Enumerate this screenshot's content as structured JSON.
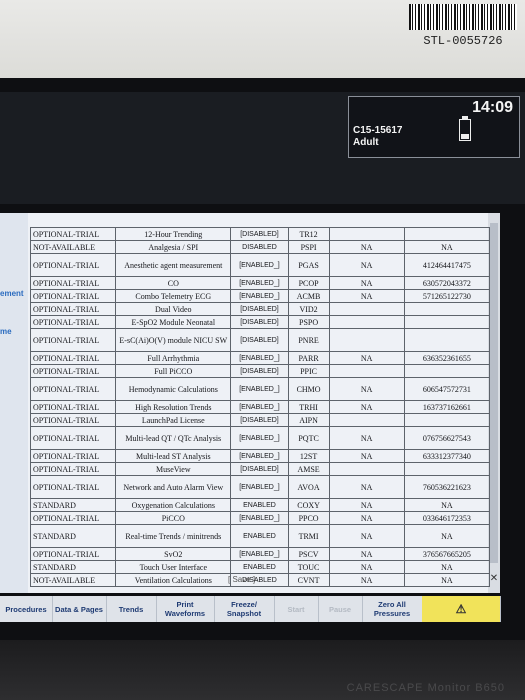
{
  "device": {
    "serial_label": "STL-0055726",
    "brand": "CARESCAPE Monitor B650"
  },
  "header": {
    "bed": "C15-15617",
    "patient_type": "Adult",
    "time": "14:09"
  },
  "side_labels": [
    "ement",
    "me"
  ],
  "table": {
    "rows": [
      [
        "OPTIONAL-TRIAL",
        "12-Hour Trending",
        "[DISABLED]",
        "TR12",
        "",
        ""
      ],
      [
        "NOT-AVAILABLE",
        "Analgesia / SPI",
        "DISABLED",
        "PSPI",
        "NA",
        "NA"
      ],
      [
        "OPTIONAL-TRIAL",
        "Anesthetic agent measurement",
        "[ENABLED_]",
        "PGAS",
        "NA",
        "412464417475"
      ],
      [
        "OPTIONAL-TRIAL",
        "CO",
        "[ENABLED_]",
        "PCOP",
        "NA",
        "630572043372"
      ],
      [
        "OPTIONAL-TRIAL",
        "Combo Telemetry ECG",
        "[ENABLED_]",
        "ACMB",
        "NA",
        "571265122730"
      ],
      [
        "OPTIONAL-TRIAL",
        "Dual Video",
        "[DISABLED]",
        "VID2",
        "",
        ""
      ],
      [
        "OPTIONAL-TRIAL",
        "E-SpO2 Module Neonatal",
        "[DISABLED]",
        "PSPO",
        "",
        ""
      ],
      [
        "OPTIONAL-TRIAL",
        "E-sC(Ai)O(V) module NICU SW",
        "[DISABLED]",
        "PNRE",
        "",
        ""
      ],
      [
        "OPTIONAL-TRIAL",
        "Full Arrhythmia",
        "[ENABLED_]",
        "PARR",
        "NA",
        "636352361655"
      ],
      [
        "OPTIONAL-TRIAL",
        "Full PiCCO",
        "[DISABLED]",
        "PPIC",
        "",
        ""
      ],
      [
        "OPTIONAL-TRIAL",
        "Hemodynamic Calculations",
        "[ENABLED_]",
        "CHMO",
        "NA",
        "606547572731"
      ],
      [
        "OPTIONAL-TRIAL",
        "High Resolution Trends",
        "[ENABLED_]",
        "TRHI",
        "NA",
        "163737162661"
      ],
      [
        "OPTIONAL-TRIAL",
        "LaunchPad License",
        "[DISABLED]",
        "AIPN",
        "",
        ""
      ],
      [
        "OPTIONAL-TRIAL",
        "Multi-lead QT / QTc Analysis",
        "[ENABLED_]",
        "PQTC",
        "NA",
        "076756627543"
      ],
      [
        "OPTIONAL-TRIAL",
        "Multi-lead ST Analysis",
        "[ENABLED_]",
        "12ST",
        "NA",
        "633312377340"
      ],
      [
        "OPTIONAL-TRIAL",
        "MuseView",
        "[DISABLED]",
        "AMSE",
        "",
        ""
      ],
      [
        "OPTIONAL-TRIAL",
        "Network and Auto Alarm View",
        "[ENABLED_]",
        "AVOA",
        "NA",
        "760536221623"
      ],
      [
        "STANDARD",
        "Oxygenation Calculations",
        "ENABLED",
        "COXY",
        "NA",
        "NA"
      ],
      [
        "OPTIONAL-TRIAL",
        "PiCCO",
        "[ENABLED_]",
        "PPCO",
        "NA",
        "033646172353"
      ],
      [
        "STANDARD",
        "Real-time Trends / minitrends",
        "ENABLED",
        "TRMI",
        "NA",
        "NA"
      ],
      [
        "OPTIONAL-TRIAL",
        "SvO2",
        "[ENABLED_]",
        "PSCV",
        "NA",
        "376567665205"
      ],
      [
        "STANDARD",
        "Touch User Interface",
        "ENABLED",
        "TOUC",
        "NA",
        "NA"
      ],
      [
        "NOT-AVAILABLE",
        "Ventilation Calculations",
        "DISABLED",
        "CVNT",
        "NA",
        "NA"
      ]
    ],
    "tall_rows": [
      2,
      7,
      10,
      13,
      16,
      19
    ]
  },
  "save_label": "[ Save ]",
  "toolbar": [
    "Procedures",
    "Data & Pages",
    "Trends",
    "Print Waveforms",
    "Freeze/ Snapshot",
    "Start",
    "Pause",
    "Zero All Pressures",
    "⚠"
  ],
  "toolbar_disabled": [
    5,
    6
  ]
}
